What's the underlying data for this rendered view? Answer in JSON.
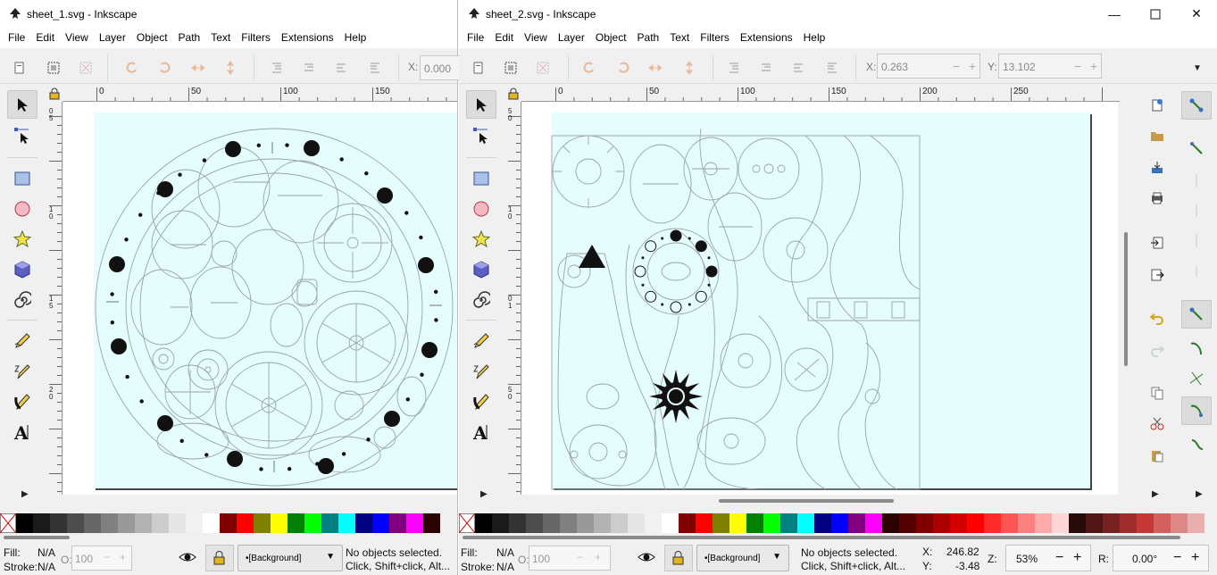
{
  "window1": {
    "title": "sheet_1.svg - Inkscape",
    "menu": [
      "File",
      "Edit",
      "View",
      "Layer",
      "Object",
      "Path",
      "Text",
      "Filters",
      "Extensions",
      "Help"
    ],
    "x_label": "X:",
    "x_value": "0.000",
    "ruler_ticks": [
      "0",
      "50",
      "100",
      "150"
    ],
    "ruler_left_ticks": [
      "0",
      "5",
      "1",
      "0",
      "1",
      "5",
      "2",
      "0"
    ],
    "status": {
      "fill_label": "Fill:",
      "fill_value": "N/A",
      "stroke_label": "Stroke:",
      "stroke_value": "N/A",
      "opacity_label": "O:",
      "opacity_value": "100",
      "layer": "[Background]",
      "message_line1": "No objects selected.",
      "message_line2": "Click, Shift+click, Alt..."
    }
  },
  "window2": {
    "title": "sheet_2.svg - Inkscape",
    "menu": [
      "File",
      "Edit",
      "View",
      "Layer",
      "Object",
      "Path",
      "Text",
      "Filters",
      "Extensions",
      "Help"
    ],
    "x_label": "X:",
    "x_value": "0.263",
    "y_label": "Y:",
    "y_value": "13.102",
    "ruler_ticks": [
      "0",
      "50",
      "100",
      "150",
      "200",
      "250"
    ],
    "ruler_left_ticks": [
      "5",
      "0",
      "1",
      "0",
      "0",
      "1",
      "5",
      "0"
    ],
    "status": {
      "fill_label": "Fill:",
      "fill_value": "N/A",
      "stroke_label": "Stroke:",
      "stroke_value": "N/A",
      "opacity_label": "O:",
      "opacity_value": "100",
      "layer": "[Background]",
      "message_line1": "No objects selected.",
      "message_line2": "Click, Shift+click, Alt...",
      "cursor_x_label": "X:",
      "cursor_x": "246.82",
      "cursor_y_label": "Y:",
      "cursor_y": "-3.48",
      "zoom_label": "Z:",
      "zoom": "53%",
      "rotate_label": "R:",
      "rotate": "0.00°"
    }
  },
  "colors": {
    "page_bg": "#e6fdfd",
    "selected_tool_bg": "#dcdcdc",
    "outline": "#9aa4a8"
  },
  "palette": [
    "#000000",
    "#1a1a1a",
    "#333333",
    "#4d4d4d",
    "#666666",
    "#808080",
    "#999999",
    "#b3b3b3",
    "#cccccc",
    "#e6e6e6",
    "#f2f2f2",
    "#ffffff",
    "#800000",
    "#ff0000",
    "#808000",
    "#ffff00",
    "#008000",
    "#00ff00",
    "#008080",
    "#00ffff",
    "#000080",
    "#0000ff",
    "#800080",
    "#ff00ff",
    "#2b0000",
    "#550000",
    "#800000",
    "#aa0000",
    "#d40000",
    "#ff0000",
    "#ff2a2a",
    "#ff5555",
    "#ff8080",
    "#ffaaaa",
    "#ffd5d5",
    "#280b0b",
    "#501616",
    "#782121",
    "#a02c2c",
    "#c83737",
    "#d35f5f",
    "#de8787",
    "#e9afaf"
  ],
  "tool_icons": [
    "selector-icon",
    "node-icon",
    "rect-icon",
    "ellipse-icon",
    "star-icon",
    "3dbox-icon",
    "spiral-icon",
    "pencil-icon",
    "pen-icon",
    "calligraphy-icon",
    "text-icon"
  ]
}
